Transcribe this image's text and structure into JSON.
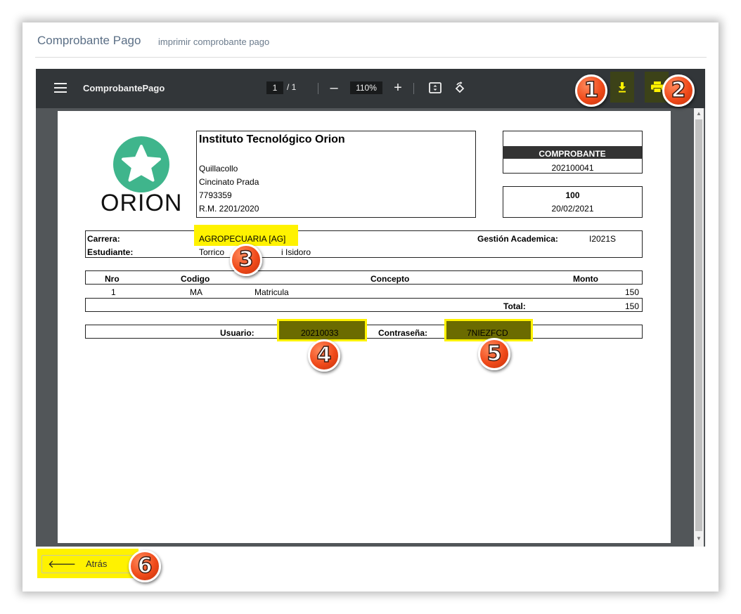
{
  "header": {
    "title": "Comprobante Pago",
    "subtitle": "imprimir comprobante pago"
  },
  "viewer": {
    "doc_name": "ComprobantePago",
    "page_current": "1",
    "page_total": "/ 1",
    "zoom": "110%",
    "zoom_out_symbol": "–",
    "zoom_in_symbol": "+"
  },
  "document": {
    "logo_text": "ORION",
    "institute": {
      "name": "Instituto Tecnológico Orion",
      "city": "Quillacollo",
      "street": "Cincinato Prada",
      "phone": "7793359",
      "rm": "R.M. 2201/2020"
    },
    "receipt": {
      "label": "COMPROBANTE",
      "number": "202100041",
      "amount": "100",
      "date": "20/02/2021"
    },
    "info": {
      "carrera_label": "Carrera:",
      "carrera_value": "AGROPECUARIA [AG]",
      "gestion_label": "Gestión Academica:",
      "gestion_value": "I2021S",
      "estudiante_label": "Estudiante:",
      "estudiante_value_a": "Torrico",
      "estudiante_value_b": "i Isidoro"
    },
    "table": {
      "headers": [
        "Nro",
        "Codigo",
        "Concepto",
        "Monto"
      ],
      "row": {
        "nro": "1",
        "codigo": "MA",
        "concepto": "Matricula",
        "monto": "150"
      },
      "total_label": "Total:",
      "total_value": "150"
    },
    "credentials": {
      "usuario_label": "Usuario:",
      "usuario_value": "20210033",
      "password_label": "Contraseña:",
      "password_value": "7NIEZFCD"
    }
  },
  "badges": [
    "1",
    "2",
    "3",
    "4",
    "5",
    "6"
  ],
  "back_button": {
    "label": "Atrás"
  },
  "colors": {
    "highlight": "#fff200",
    "badge": "#f04a1a",
    "logo": "#3fb58c",
    "toolbar": "#323639"
  }
}
